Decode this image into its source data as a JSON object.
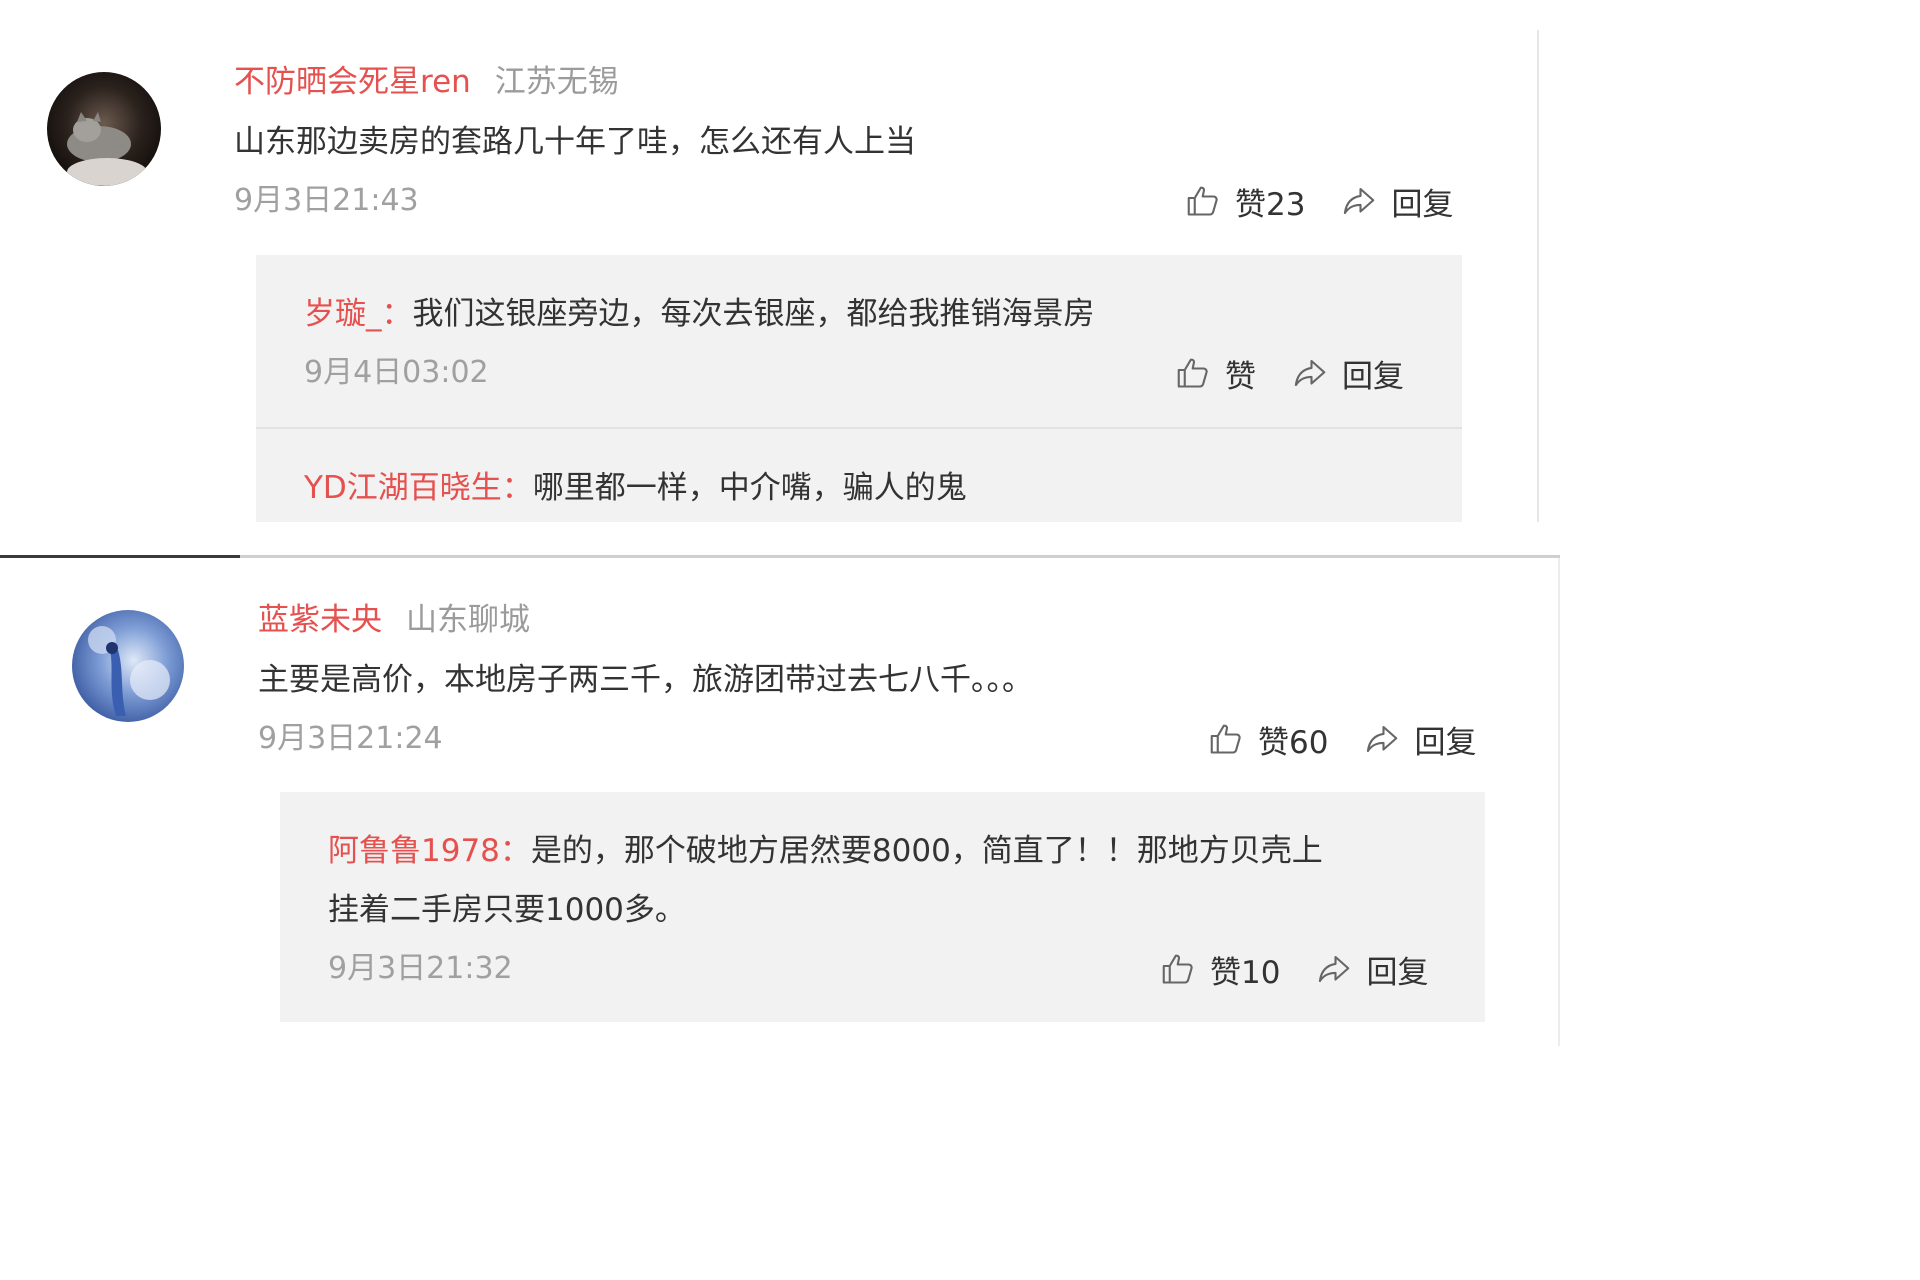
{
  "comments": [
    {
      "user": "不防晒会死星ren",
      "location": "江苏无锡",
      "text": "山东那边卖房的套路几十年了哇，怎么还有人上当",
      "time": "9月3日21:43",
      "like_label": "赞23",
      "reply_label": "回复",
      "replies": [
        {
          "user": "岁璇_：",
          "text": "我们这银座旁边，每次去银座，都给我推销海景房",
          "time": "9月4日03:02",
          "like_label": "赞",
          "reply_label": "回复"
        },
        {
          "user": "YD江湖百晓生：",
          "text": "哪里都一样，中介嘴，骗人的鬼"
        }
      ]
    },
    {
      "user": "蓝紫未央",
      "location": "山东聊城",
      "text": "主要是高价，本地房子两三千，旅游团带过去七八千。。。",
      "time": "9月3日21:24",
      "like_label": "赞60",
      "reply_label": "回复",
      "replies": [
        {
          "user": "阿鲁鲁1978：",
          "text_line1": "是的，那个破地方居然要8000，简直了！！那地方贝壳上",
          "text_line2": "挂着二手房只要1000多。",
          "time": "9月3日21:32",
          "like_label": "赞10",
          "reply_label": "回复"
        }
      ]
    }
  ],
  "icons": {
    "like": "thumbs-up-icon",
    "reply": "forward-arrow-icon"
  },
  "colors": {
    "username": "#e4514f",
    "muted": "#9b9b9b",
    "reply_bg": "#f2f2f2"
  }
}
